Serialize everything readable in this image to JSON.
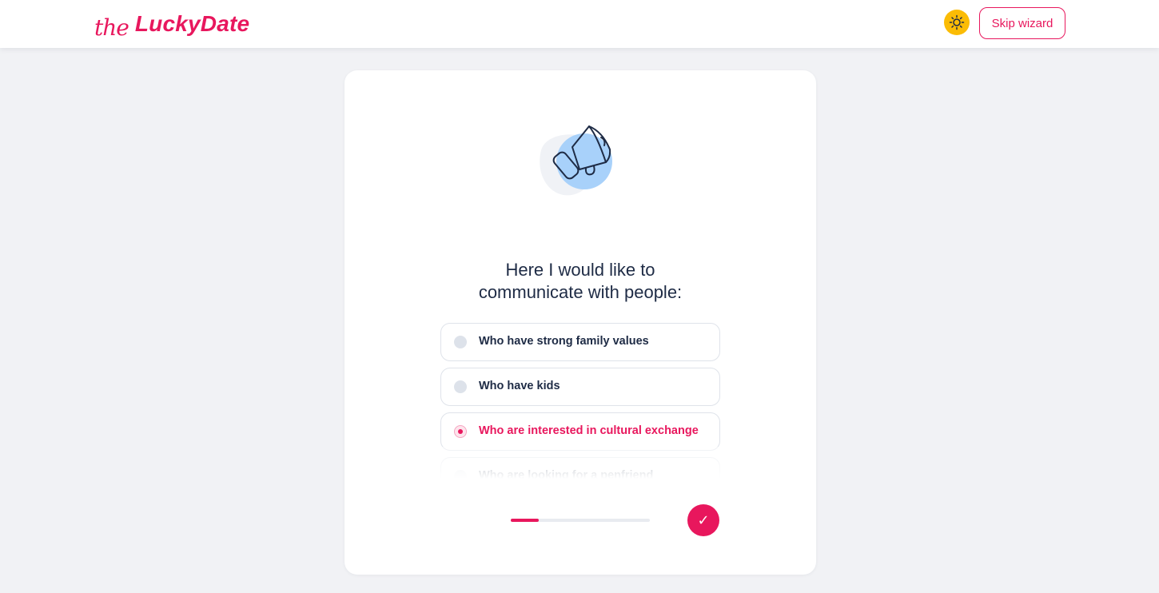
{
  "header": {
    "logo_prefix": "the",
    "logo_name": "LuckyDate",
    "theme_toggle_icon": "sun-icon",
    "skip_label": "Skip wizard"
  },
  "wizard": {
    "illustration_icon": "megaphone-icon",
    "question_line1": "Here I would like to",
    "question_line2": "communicate with people:",
    "options": [
      {
        "label": "Who have strong family values",
        "selected": false
      },
      {
        "label": "Who have kids",
        "selected": false
      },
      {
        "label": "Who are interested in cultural exchange",
        "selected": true
      },
      {
        "label": "Who are looking for a penfriend",
        "selected": false
      }
    ],
    "progress": 0.2,
    "confirm_icon": "checkmark-icon",
    "confirm_glyph": "✓"
  },
  "colors": {
    "accent": "#e8175d",
    "toggle": "#fbbc05",
    "text": "#1e2b45",
    "background": "#f1f2f5",
    "illustration_blue": "#a8d1fa"
  }
}
